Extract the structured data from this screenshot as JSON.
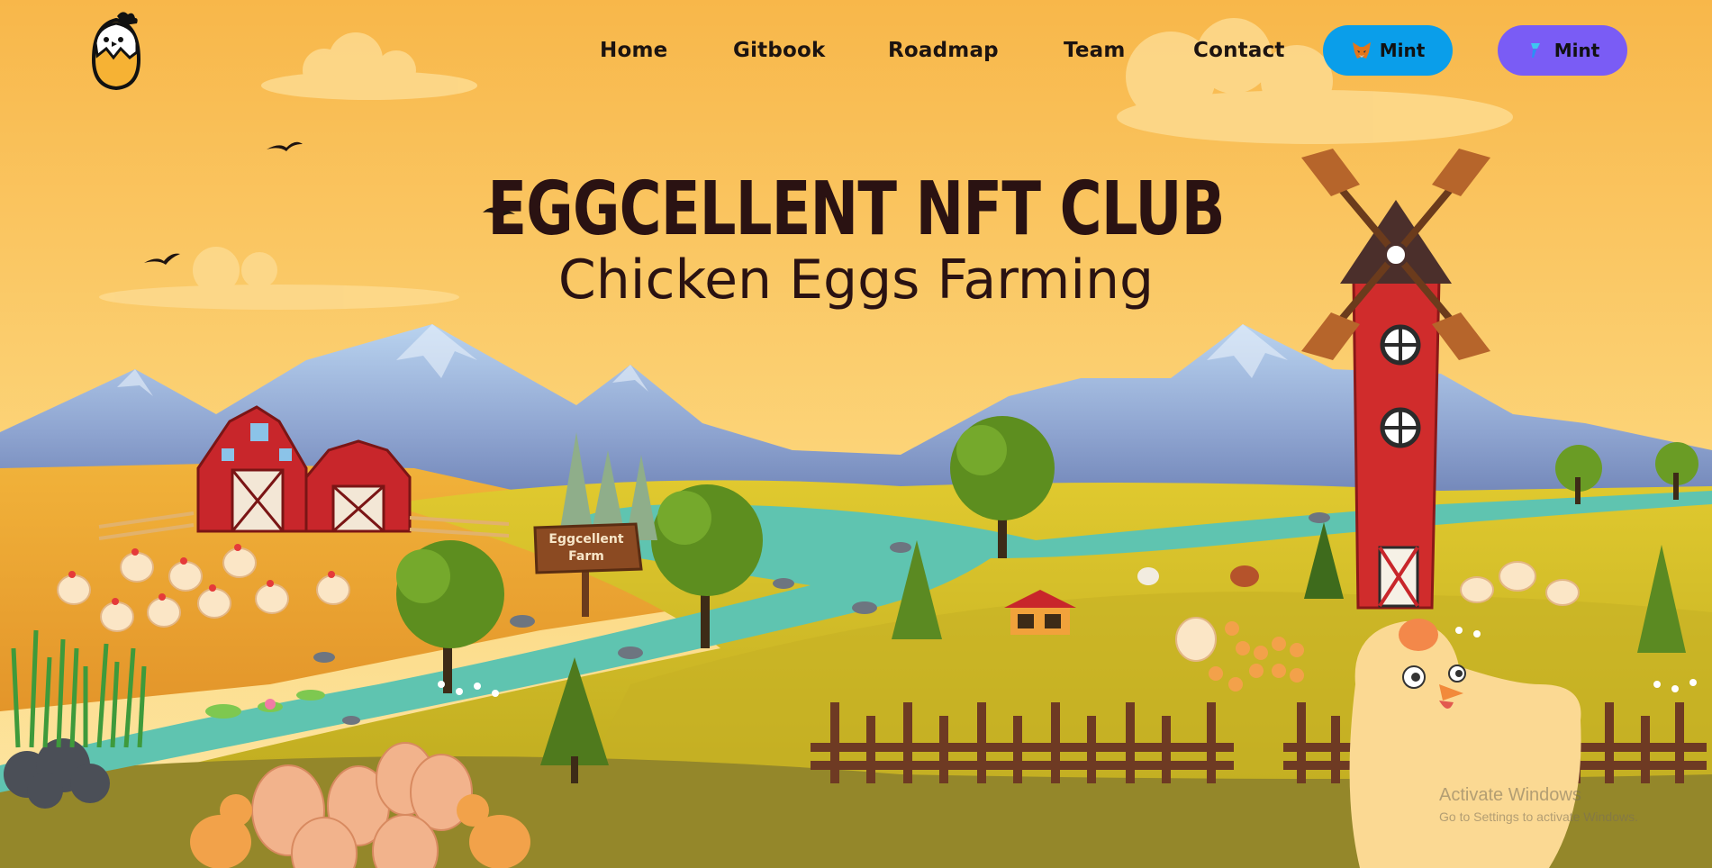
{
  "nav": {
    "links": [
      "Home",
      "Gitbook",
      "Roadmap",
      "Team",
      "Contact"
    ],
    "mint_metamask": {
      "label": "Mint",
      "color": "#0a9eea",
      "icon": "metamask-fox-icon"
    },
    "mint_wallet": {
      "label": "Mint",
      "color": "#7a5cf5",
      "icon": "wallet-logo-icon"
    }
  },
  "hero": {
    "title": "EGGCELLENT NFT CLUB",
    "subtitle": "Chicken Eggs Farming"
  },
  "scene": {
    "sign_line1": "Eggcellent",
    "sign_line2": "Farm"
  },
  "watermark": {
    "line1": "Activate Windows",
    "line2": "Go to Settings to activate Windows."
  },
  "colors": {
    "sky_top": "#f8b94c",
    "sky_bottom": "#fde7a3",
    "mountain": "#8aa3cf",
    "barn": "#c8262b",
    "river": "#5fc4b0",
    "grass": "#d6c22b",
    "fence": "#6e3a23",
    "title": "#2a1212"
  }
}
